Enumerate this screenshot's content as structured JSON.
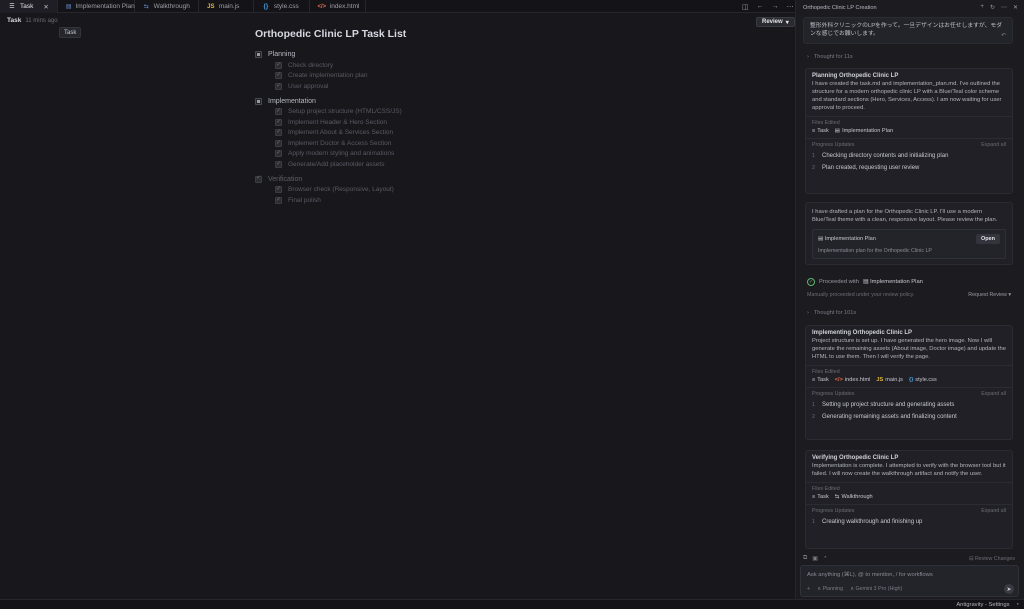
{
  "tabs": [
    {
      "label": "Task",
      "icon": "list-icon",
      "active": true
    },
    {
      "label": "Implementation Plan",
      "icon": "doc-icon"
    },
    {
      "label": "Walkthrough",
      "icon": "doc-icon"
    },
    {
      "label": "main.js",
      "icon": "js-file-icon"
    },
    {
      "label": "style.css",
      "icon": "css-file-icon"
    },
    {
      "label": "index.html",
      "icon": "html-file-icon"
    }
  ],
  "editor": {
    "title": "Task",
    "meta": "11 mins ago",
    "tooltip": "Task",
    "review_label": "Review"
  },
  "doc": {
    "title": "Orthopedic Clinic LP Task List",
    "sections": [
      {
        "label": "Planning",
        "items": [
          "Check directory",
          "Create implementation plan",
          "User approval"
        ]
      },
      {
        "label": "Implementation",
        "items": [
          "Setup project structure (HTML/CSS/JS)",
          "Implement Header & Hero Section",
          "Implement About & Services Section",
          "Implement Doctor & Access Section",
          "Apply modern styling and animations",
          "Generate/Add placeholder assets"
        ]
      },
      {
        "label": "Verification",
        "items": [
          "Browser check (Responsive, Layout)",
          "Final polish"
        ]
      }
    ]
  },
  "panel": {
    "title": "Orthopedic Clinic LP Creation",
    "user_message": "整形外科クリニックのLPを作って。一旦デザインはお任せしますが、モダンな感じでお願いします。",
    "thought1": "Thought for 11s",
    "block1": {
      "title": "Planning Orthopedic Clinic LP",
      "text": "I have created the task.md and implementation_plan.md. I've outlined the structure for a modern orthopedic clinic LP with a Blue/Teal color scheme and standard sections (Hero, Services, Access). I am now waiting for user approval to proceed.",
      "files_label": "Files Edited",
      "files": [
        "Task",
        "Implementation Plan"
      ],
      "progress_label": "Progress Updates",
      "expand_label": "Expand all",
      "updates": [
        {
          "n": "1",
          "text": "Checking directory contents and initializing plan"
        },
        {
          "n": "2",
          "text": "Plan created, requesting user review"
        }
      ]
    },
    "message2": {
      "text": "I have drafted a plan for the Orthopedic Clinic LP. I'll use a modern Blue/Teal theme with a clean, responsive layout. Please review the plan.",
      "artifact_name": "Implementation Plan",
      "open_label": "Open",
      "artifact_desc": "Implementation plan for the Orthopedic Clinic LP"
    },
    "proceeded": {
      "label": "Proceeded with",
      "target": "Implementation Plan"
    },
    "policy": {
      "text": "Manually proceeded under your review policy.",
      "action": "Request Review"
    },
    "thought2": "Thought for 101s",
    "block2": {
      "title": "Implementing Orthopedic Clinic LP",
      "text": "Project structure is set up. I have generated the hero image. Now I will generate the remaining assets (About image, Doctor image) and update the HTML to use them. Then I will verify the page.",
      "files_label": "Files Edited",
      "files": [
        "Task",
        "index.html",
        "main.js",
        "style.css"
      ],
      "progress_label": "Progress Updates",
      "expand_label": "Expand all",
      "updates": [
        {
          "n": "1",
          "text": "Setting up project structure and generating assets"
        },
        {
          "n": "2",
          "text": "Generating remaining assets and finalizing content"
        }
      ]
    },
    "block3": {
      "title": "Verifying Orthopedic Clinic LP",
      "text": "Implementation is complete. I attempted to verify with the browser tool but it failed. I will now create the walkthrough artifact and notify the user.",
      "files_label": "Files Edited",
      "files": [
        "Task",
        "Walkthrough"
      ],
      "progress_label": "Progress Updates",
      "expand_label": "Expand all",
      "updates": [
        {
          "n": "1",
          "text": "Creating walkthrough and finishing up"
        }
      ]
    },
    "review_changes": "Review Changes",
    "input_placeholder": "Ask anything (⌘L), @ to mention, / for workflows",
    "mode": "Planning",
    "model": "Gemini 3 Pro (High)"
  },
  "status": {
    "label": "Antigravity - Settings"
  }
}
